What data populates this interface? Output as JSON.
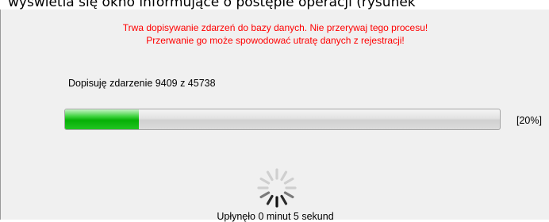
{
  "background_caption": "wyświetla się okno informujące o postępie operacji (rysunek",
  "warning": {
    "line1": "Trwa dopisywanie zdarzeń do bazy danych. Nie przerywaj tego procesu!",
    "line2": "Przerwanie go może spowodować utratę danych z rejestracji!",
    "color": "#ff0000"
  },
  "status_text": "Dopisuję zdarzenie 9409 z 45738",
  "progress": {
    "fraction": 0.17,
    "label": "[20%]",
    "fill_color": "#1cbf1c"
  },
  "spinner_icon": "loading-spinner-icon",
  "elapsed_text": "Upłynęło 0 minut 5 sekund"
}
